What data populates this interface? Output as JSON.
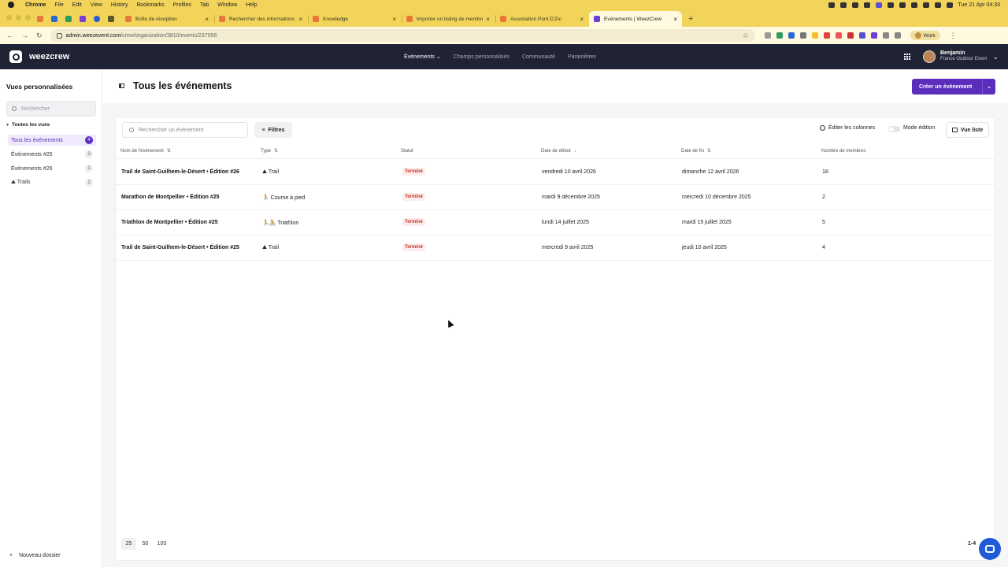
{
  "macmenu": {
    "app": "Chrome",
    "items": [
      "File",
      "Edit",
      "View",
      "History",
      "Bookmarks",
      "Profiles",
      "Tab",
      "Window",
      "Help"
    ],
    "clock": "Tue 21 Apr  04:33"
  },
  "tabs": [
    {
      "title": "Boîte de réception",
      "color": "#e8773a"
    },
    {
      "title": "Rechercher des informations",
      "color": "#e8773a"
    },
    {
      "title": "Knowledge",
      "color": "#e8773a"
    },
    {
      "title": "Importer un listing de membres",
      "color": "#e8773a"
    },
    {
      "title": "Association Pont D'Zic",
      "color": "#e8773a"
    },
    {
      "title": "Événements | WeezCrew",
      "color": "#6b3fd4",
      "active": true
    }
  ],
  "address": {
    "host": "admin.weezevent.com",
    "path": "/crew/organization/3810/events/237056"
  },
  "profile": {
    "label": "Work"
  },
  "app": {
    "brand": "weezcrew",
    "nav": [
      "Événements",
      "Champs personnalisés",
      "Communauté",
      "Paramètres"
    ],
    "user_name": "Benjamin",
    "user_org": "France Outdoor Event"
  },
  "sidebar": {
    "title": "Vues personnalisées",
    "search_placeholder": "Rechercher",
    "all_views": "Toutes les vues",
    "items": [
      {
        "label": "Tous les événements",
        "count": "4"
      },
      {
        "label": "Événements #25",
        "count": "3"
      },
      {
        "label": "Événements #26",
        "count": "1"
      },
      {
        "label": "⛰ Trails",
        "count": "2"
      }
    ],
    "new_folder": "Nouveau dossier"
  },
  "page": {
    "title": "Tous les événements",
    "create_label": "Créer un événement",
    "search_placeholder": "Rechercher un événement",
    "filters_label": "Filtres",
    "columns_label": "Éditer les colonnes",
    "edit_mode_label": "Mode édition",
    "view_label": "Vue liste"
  },
  "table": {
    "headers": [
      "Nom de l'événement",
      "Type",
      "Statut",
      "Date de début",
      "Date de fin",
      "Nombre de membres"
    ],
    "rows": [
      {
        "name": "Trail de Saint-Guilhem-le-Désert • Édition #26",
        "type": "⛰ Trail",
        "status": "Terminé",
        "start": "vendredi 10 avril 2026",
        "end": "dimanche 12 avril 2026",
        "members": "18"
      },
      {
        "name": "Marathon de Montpellier • Édition #25",
        "type": "🏃 Course à pied",
        "status": "Terminé",
        "start": "mardi 9 décembre 2025",
        "end": "mercredi 10 décembre 2025",
        "members": "2"
      },
      {
        "name": "Triathlon de Montpellier • Édition #25",
        "type": "🏃🚴 Triathlon",
        "status": "Terminé",
        "start": "lundi 14 juillet 2025",
        "end": "mardi 15 juillet 2025",
        "members": "5"
      },
      {
        "name": "Trail de Saint-Guilhem-le-Désert • Édition #25",
        "type": "⛰ Trail",
        "status": "Terminé",
        "start": "mercredi 9 avril 2025",
        "end": "jeudi 10 avril 2025",
        "members": "4"
      }
    ]
  },
  "pagination": {
    "sizes": [
      "25",
      "50",
      "100"
    ],
    "range": "1-4"
  }
}
